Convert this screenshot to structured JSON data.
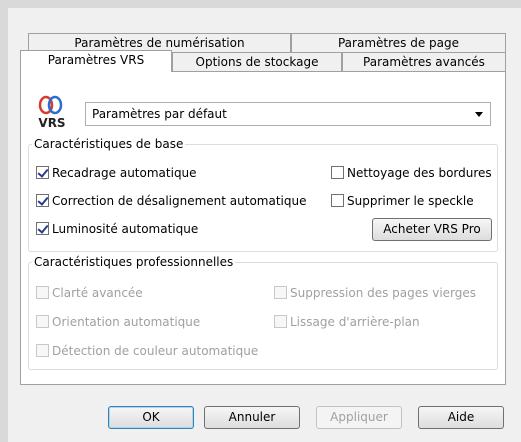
{
  "tabs_row1": [
    {
      "label": "Paramètres de numérisation"
    },
    {
      "label": "Paramètres de page"
    }
  ],
  "tabs_row2": [
    {
      "label": "Paramètres VRS",
      "selected": true
    },
    {
      "label": "Options de stockage"
    },
    {
      "label": "Paramètres avancés"
    }
  ],
  "logo": {
    "text": "VRS"
  },
  "profile_select": {
    "value": "Paramètres par défaut"
  },
  "basic_group": {
    "title": "Caractéristiques de base",
    "options": [
      {
        "label": "Recadrage automatique",
        "checked": true
      },
      {
        "label": "Nettoyage des bordures",
        "checked": false
      },
      {
        "label": "Correction de désalignement automatique",
        "checked": true
      },
      {
        "label": "Supprimer le speckle",
        "checked": false
      },
      {
        "label": "Luminosité automatique",
        "checked": true
      }
    ],
    "buy_button": "Acheter VRS Pro"
  },
  "pro_group": {
    "title": "Caractéristiques professionnelles",
    "options": [
      {
        "label": "Clarté avancée",
        "checked": false
      },
      {
        "label": "Suppression des pages vierges",
        "checked": false
      },
      {
        "label": "Orientation automatique",
        "checked": false
      },
      {
        "label": "Lissage d'arrière-plan",
        "checked": false
      },
      {
        "label": "Détection de couleur automatique",
        "checked": false
      }
    ]
  },
  "buttons": {
    "ok": "OK",
    "cancel": "Annuler",
    "apply": "Appliquer",
    "help": "Aide"
  },
  "colors": {
    "checkmark": "#2b3a8c",
    "logo_red": "#d83a2b",
    "logo_blue": "#2a6fcf"
  }
}
